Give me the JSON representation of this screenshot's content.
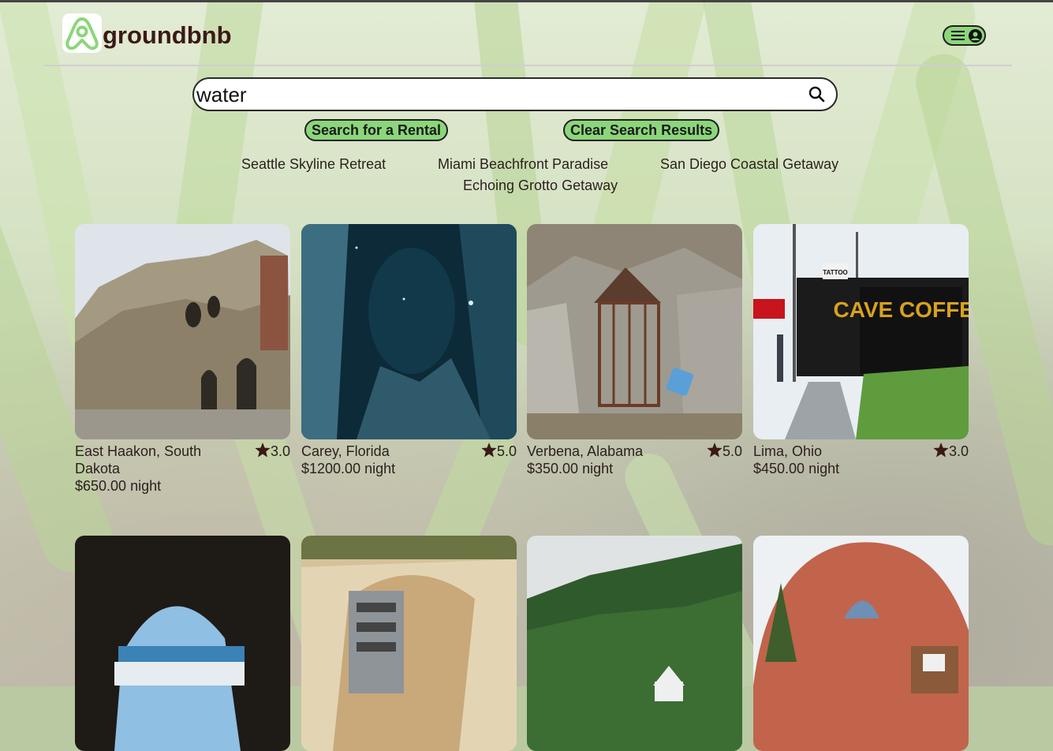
{
  "app": {
    "brand": "groundbnb"
  },
  "header": {
    "menu_icon": "hamburger-icon",
    "account_icon": "user-circle-icon"
  },
  "search": {
    "value": "water",
    "icon": "magnifier-icon"
  },
  "actions": {
    "search_label": "Search for a Rental",
    "clear_label": "Clear Search Results"
  },
  "search_results": [
    "Seattle Skyline Retreat",
    "Miami Beachfront Paradise",
    "San Diego Coastal Getaway",
    "Echoing Grotto Getaway"
  ],
  "listings": [
    {
      "location": "East Haakon, South Dakota",
      "price": "$650.00 night",
      "rating": "3.0"
    },
    {
      "location": "Carey, Florida",
      "price": "$1200.00 night",
      "rating": "5.0"
    },
    {
      "location": "Verbena, Alabama",
      "price": "$350.00 night",
      "rating": "5.0"
    },
    {
      "location": "Lima, Ohio",
      "price": "$450.00 night",
      "rating": "3.0"
    }
  ],
  "thumb_signs": {
    "cafe": "CAVE COFFEE",
    "tattoo": "TATTOO"
  },
  "colors": {
    "accent": "#8bd67a",
    "brand_text": "#3b1a16",
    "star": "#3b1a16"
  }
}
